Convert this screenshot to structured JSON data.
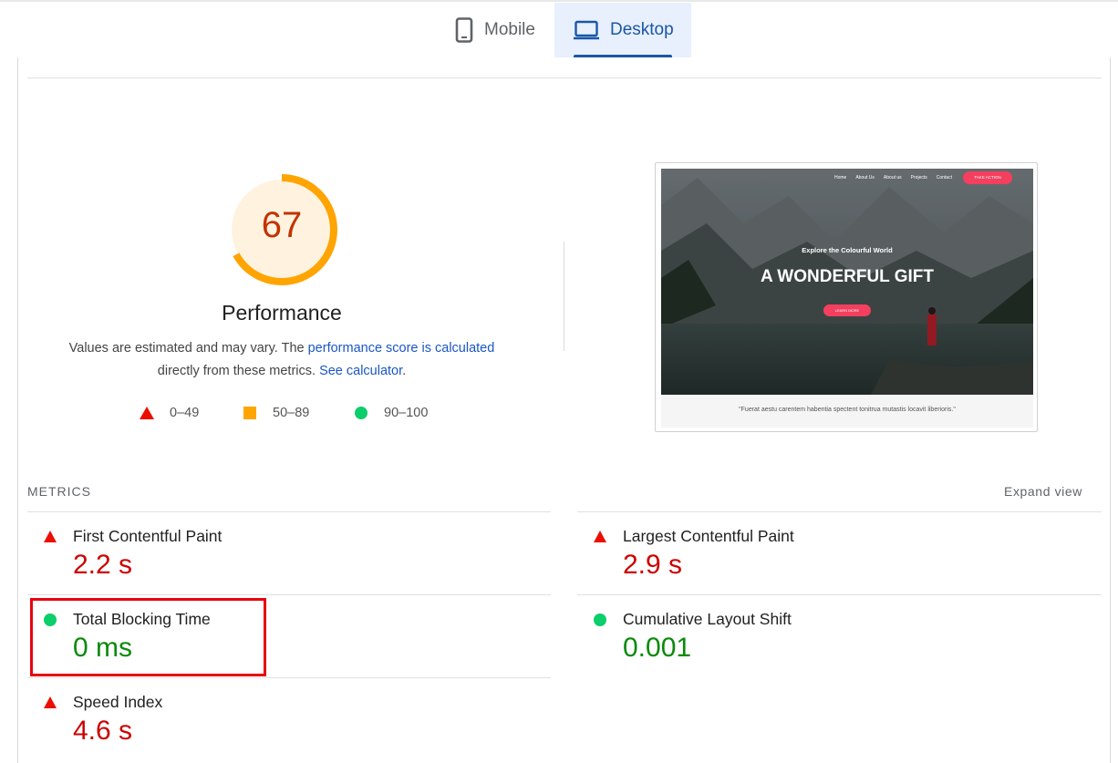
{
  "tabs": {
    "mobile": "Mobile",
    "desktop": "Desktop"
  },
  "performance": {
    "score": "67",
    "score_fraction": 0.67,
    "title": "Performance",
    "desc_part1": "Values are estimated and may vary. The ",
    "desc_link1": "performance score is calculated",
    "desc_part2": "directly from these metrics. ",
    "desc_link2": "See calculator",
    "desc_end": "."
  },
  "legend": {
    "fail": "0–49",
    "average": "50–89",
    "pass": "90–100"
  },
  "screenshot": {
    "nav": [
      "Home",
      "About Us",
      "About us",
      "Projects",
      "Contact"
    ],
    "cta": "TAKE ACTION",
    "subtitle": "Explore the Colourful World",
    "headline": "A WONDERFUL GIFT",
    "button": "LEARN MORE",
    "quote": "\"Fuerat aestu carentem habentia spectent tonitrua mutastis locavit liberioris.\""
  },
  "metrics": {
    "label": "METRICS",
    "expand": "Expand view",
    "fcp": {
      "name": "First Contentful Paint",
      "value": "2.2 s"
    },
    "lcp": {
      "name": "Largest Contentful Paint",
      "value": "2.9 s"
    },
    "tbt": {
      "name": "Total Blocking Time",
      "value": "0 ms"
    },
    "cls": {
      "name": "Cumulative Layout Shift",
      "value": "0.001"
    },
    "si": {
      "name": "Speed Index",
      "value": "4.6 s"
    }
  },
  "colors": {
    "fail": "#eb0f00",
    "average": "#ffa400",
    "pass": "#0cce6b",
    "accent": "#1a56a8"
  }
}
